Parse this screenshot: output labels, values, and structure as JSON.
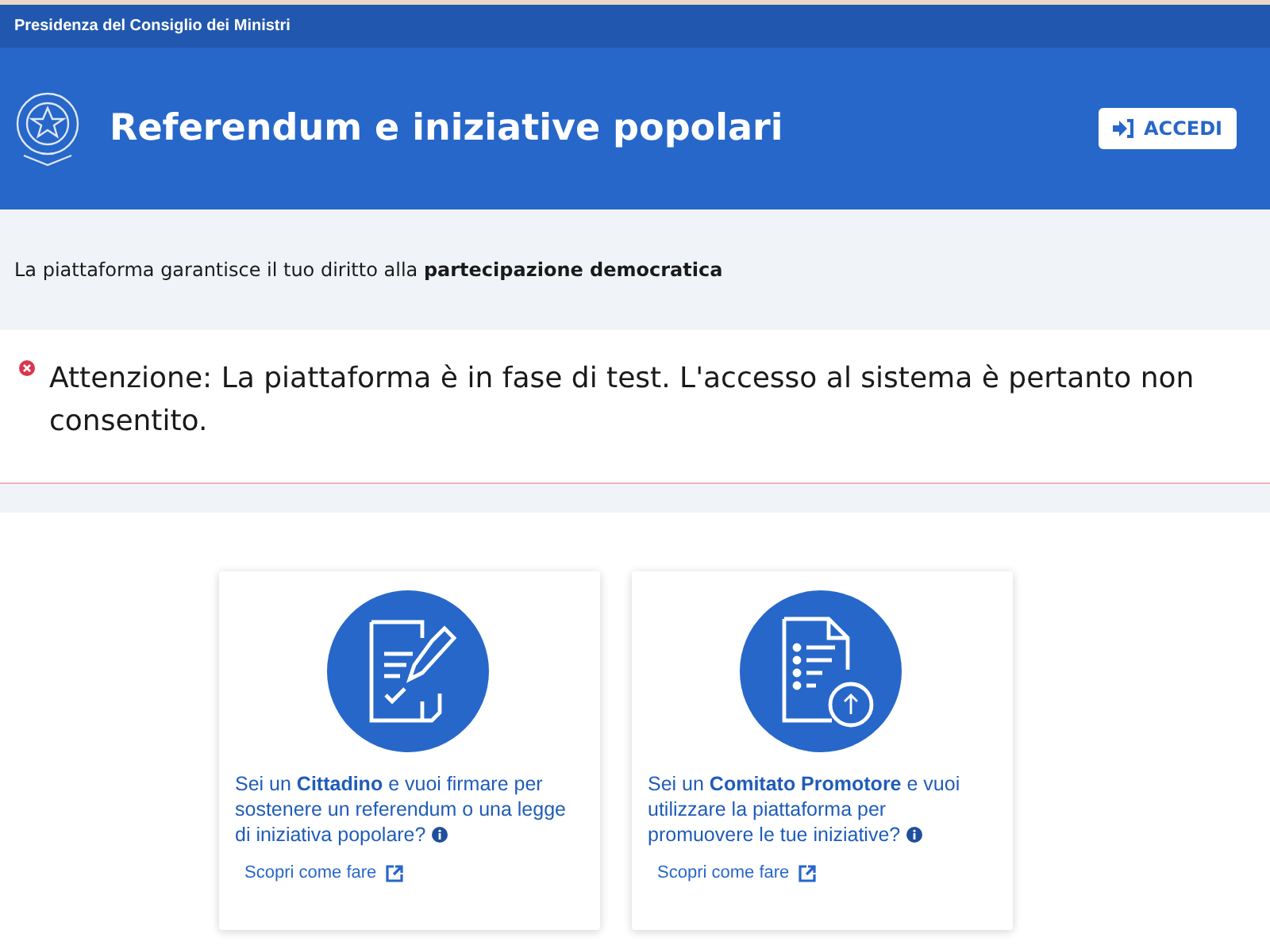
{
  "top_bar": {
    "title": "Presidenza del Consiglio dei Ministri"
  },
  "header": {
    "title": "Referendum e iniziative popolari",
    "login_button": "ACCEDI"
  },
  "tagline": "La piattaforma garantisce il tuo diritto alla **partecipazione democratica**",
  "alert": {
    "kind": "error",
    "message": "Attenzione: La piattaforma è in fase di test. L'accesso al sistema è pertanto non consentito."
  },
  "cards": [
    {
      "kind": "sign",
      "text": "Sei un **Cittadino** e vuoi firmare per sostenere un referendum o una legge di iniziativa popolare?",
      "link": "Scopri come fare"
    },
    {
      "kind": "upload",
      "text": "Sei un **Comitato Promotore** e vuoi utilizzare la piattaforma per promuovere le tue iniziative?",
      "link": "Scopri come fare"
    }
  ]
}
